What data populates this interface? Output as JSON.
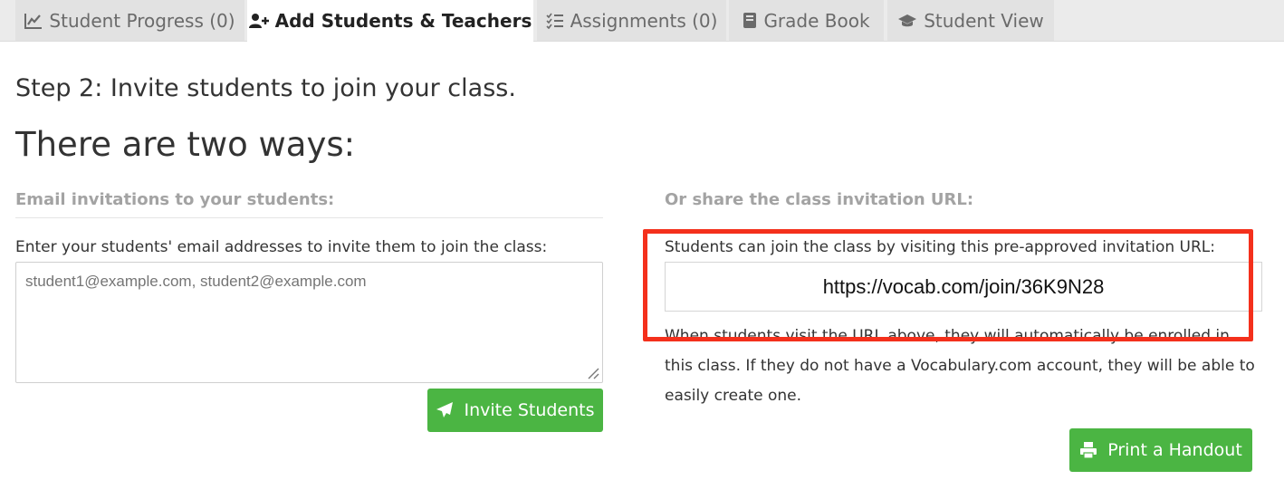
{
  "tabs": [
    {
      "label": "Student Progress (0)",
      "icon": "line-chart-icon",
      "active": false
    },
    {
      "label": "Add Students & Teachers",
      "icon": "user-plus-icon",
      "active": true
    },
    {
      "label": "Assignments (0)",
      "icon": "checklist-icon",
      "active": false
    },
    {
      "label": "Grade Book",
      "icon": "book-icon",
      "active": false
    },
    {
      "label": "Student View",
      "icon": "graduation-cap-icon",
      "active": false
    }
  ],
  "main": {
    "step_title": "Step 2: Invite students to join your class.",
    "ways_heading": "There are two ways:"
  },
  "email_section": {
    "heading": "Email invitations to your students:",
    "label": "Enter your students' email addresses to invite them to join the class:",
    "placeholder": "student1@example.com, student2@example.com",
    "value": "",
    "button_label": "Invite Students",
    "button_icon": "paper-plane-icon"
  },
  "url_section": {
    "heading": "Or share the class invitation URL:",
    "label": "Students can join the class by visiting this pre-approved invitation URL:",
    "url": "https://vocab.com/join/36K9N28",
    "description": "When students visit the URL above, they will automatically be enrolled in this class. If they do not have a Vocabulary.com account, they will be able to easily create one.",
    "button_label": "Print a Handout",
    "button_icon": "printer-icon"
  },
  "colors": {
    "primary_button": "#4bb543",
    "highlight_border": "#f4301c",
    "section_heading": "#a3a3a3"
  }
}
